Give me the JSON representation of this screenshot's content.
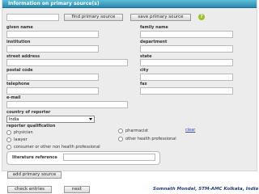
{
  "form": {
    "title": "Information on primary source(s)",
    "find_button": "find primary source",
    "save_button": "save primary source",
    "help_icon": "?",
    "fields": {
      "given_name": "given name",
      "family_name": "family name",
      "institution": "institution",
      "department": "department",
      "street_address": "street address",
      "state": "state",
      "postal_code": "postal code",
      "city": "city",
      "telephone": "telephone",
      "fax": "fax",
      "email": "e-mail",
      "country": "country of reporter",
      "country_value": "India",
      "qualification": "reporter qualification",
      "literature": "literature reference"
    },
    "qualifications": [
      "physician",
      "pharmacist",
      "lawyer",
      "other health professional",
      "consumer or other non health professional"
    ],
    "clear_link": "clear"
  },
  "footer": {
    "add_button": "add primary source",
    "check_button": "check entries",
    "next_button": "next",
    "credit": "Somnath Mondal, STM-AMC Kolkata, India"
  },
  "colors": {
    "title_bar": "#2c88b0",
    "help_icon": "#9bbf2a",
    "credit": "#233c7a"
  }
}
